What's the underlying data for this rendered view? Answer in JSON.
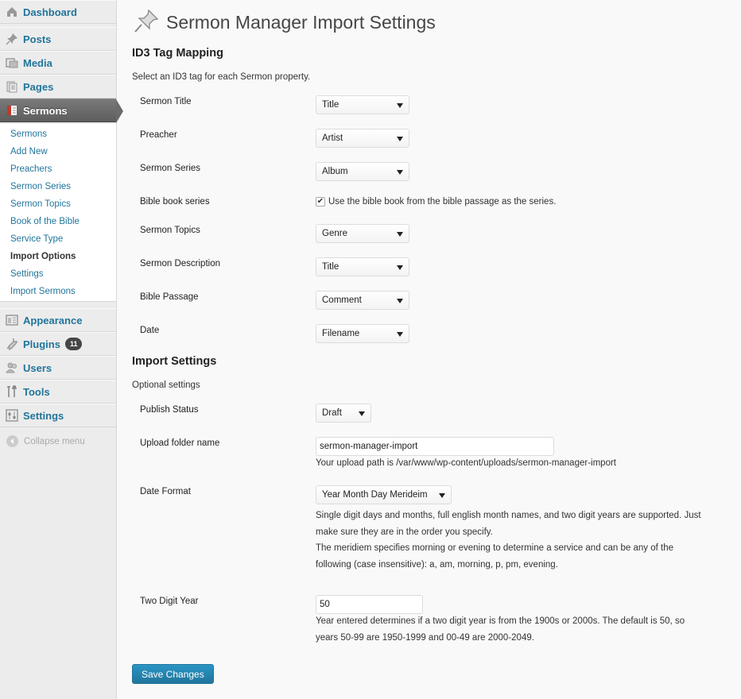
{
  "sidebar": {
    "dashboard": {
      "label": "Dashboard",
      "icon": "dashboard-icon"
    },
    "posts": {
      "label": "Posts",
      "icon": "pushpin-icon"
    },
    "media": {
      "label": "Media",
      "icon": "media-icon"
    },
    "pages": {
      "label": "Pages",
      "icon": "pages-icon"
    },
    "sermons": {
      "label": "Sermons",
      "icon": "book-icon"
    },
    "submenu": [
      "Sermons",
      "Add New",
      "Preachers",
      "Sermon Series",
      "Sermon Topics",
      "Book of the Bible",
      "Service Type",
      "Import Options",
      "Settings",
      "Import Sermons"
    ],
    "current_submenu": "Import Options",
    "appearance": {
      "label": "Appearance",
      "icon": "appearance-icon"
    },
    "plugins": {
      "label": "Plugins",
      "icon": "plugin-icon",
      "badge": "11"
    },
    "users": {
      "label": "Users",
      "icon": "users-icon"
    },
    "tools": {
      "label": "Tools",
      "icon": "tools-icon"
    },
    "settings": {
      "label": "Settings",
      "icon": "settings-icon"
    },
    "collapse": {
      "label": "Collapse menu",
      "icon": "collapse-arrow-icon"
    }
  },
  "page": {
    "title": "Sermon Manager Import Settings",
    "title_icon": "pushpin-icon"
  },
  "id3": {
    "heading": "ID3 Tag Mapping",
    "description": "Select an ID3 tag for each Sermon property.",
    "rows": {
      "sermon_title": {
        "label": "Sermon Title",
        "value": "Title"
      },
      "preacher": {
        "label": "Preacher",
        "value": "Artist"
      },
      "sermon_series": {
        "label": "Sermon Series",
        "value": "Album"
      },
      "bible_book_series": {
        "label": "Bible book series",
        "checkbox_label": "Use the bible book from the bible passage as the series.",
        "checked": true
      },
      "sermon_topics": {
        "label": "Sermon Topics",
        "value": "Genre"
      },
      "sermon_description": {
        "label": "Sermon Description",
        "value": "Title"
      },
      "bible_passage": {
        "label": "Bible Passage",
        "value": "Comment"
      },
      "date": {
        "label": "Date",
        "value": "Filename"
      }
    }
  },
  "import": {
    "heading": "Import Settings",
    "description": "Optional settings",
    "publish_status": {
      "label": "Publish Status",
      "value": "Draft"
    },
    "upload_folder": {
      "label": "Upload folder name",
      "value": "sermon-manager-import",
      "help": "Your upload path is /var/www/wp-content/uploads/sermon-manager-import"
    },
    "date_format": {
      "label": "Date Format",
      "value": "Year Month Day Merideim",
      "help_lines": [
        "Single digit days and months, full english month names, and two digit years are supported. Just",
        "make sure they are in the order you specify.",
        "The meridiem specifies morning or evening to determine a service and can be any of the",
        "following (case insensitive): a, am, morning, p, pm, evening."
      ]
    },
    "two_digit_year": {
      "label": "Two Digit Year",
      "value": "50",
      "help_lines": [
        "Year entered determines if a two digit year is from the 1900s or 2000s. The default is 50, so",
        "years 50-99 are 1950-1999 and 00-49 are 2000-2049."
      ]
    }
  },
  "save_button": "Save Changes",
  "colors": {
    "link": "#21759b",
    "primary_button": "#21759b",
    "current_menu_bg": "#6b6b6b"
  }
}
